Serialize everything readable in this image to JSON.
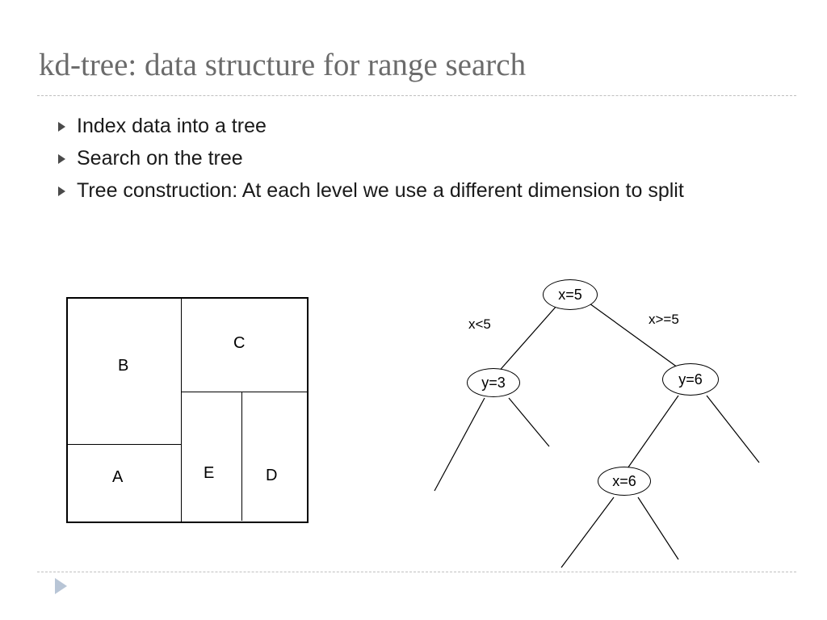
{
  "title": "kd-tree: data structure for range search",
  "bullets": [
    "Index data into a tree",
    "Search on the tree",
    "Tree construction: At each level we use a different dimension to split"
  ],
  "partition": {
    "labels": {
      "A": "A",
      "B": "B",
      "C": "C",
      "D": "D",
      "E": "E"
    }
  },
  "tree": {
    "root": "x=5",
    "leftEdge": "x<5",
    "rightEdge": "x>=5",
    "leftChild": "y=3",
    "rightChild": "y=6",
    "rcLeftChild": "x=6"
  }
}
